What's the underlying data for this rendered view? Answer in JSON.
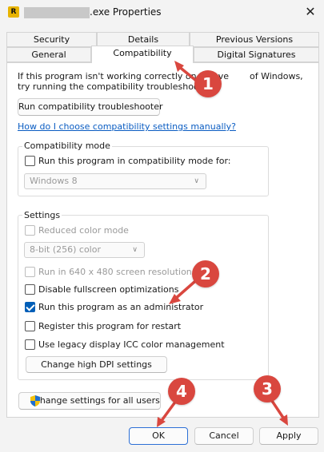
{
  "window": {
    "app_icon_letter": "R",
    "title": ".exe Properties",
    "close_icon": "close-icon"
  },
  "tabs_top": [
    {
      "label": "Security"
    },
    {
      "label": "Details"
    },
    {
      "label": "Previous Versions"
    }
  ],
  "tabs_bottom": [
    {
      "label": "General"
    },
    {
      "label": "Compatibility"
    },
    {
      "label": "Digital Signatures"
    }
  ],
  "active_tab": "Compatibility",
  "intro": {
    "line1_start": "If this program isn't working correctly on this ve",
    "line1_end": "of Windows,",
    "line2": "try running the compatibility troubleshooter."
  },
  "troubleshoot_button": "Run compatibility troubleshooter",
  "help_link": "How do I choose compatibility settings manually?",
  "compat_mode": {
    "label": "Compatibility mode",
    "checkbox_label": "Run this program in compatibility mode for:",
    "checked": false,
    "selected_os": "Windows 8"
  },
  "settings": {
    "label": "Settings",
    "reduced_color": {
      "label": "Reduced color mode",
      "checked": false
    },
    "color_select": "8-bit (256) color",
    "run_640": {
      "label": "Run in 640 x 480 screen resolution",
      "checked": false
    },
    "disable_fullscreen": {
      "label": "Disable fullscreen optimizations",
      "checked": false
    },
    "run_admin": {
      "label": "Run this program as an administrator",
      "checked": true
    },
    "register_restart": {
      "label": "Register this program for restart",
      "checked": false
    },
    "legacy_icc": {
      "label": "Use legacy display ICC color management",
      "checked": false
    },
    "dpi_button": "Change high DPI settings"
  },
  "all_users_button": "Change settings for all users",
  "footer": {
    "ok": "OK",
    "cancel": "Cancel",
    "apply": "Apply"
  },
  "annotations": [
    {
      "number": "1"
    },
    {
      "number": "2"
    },
    {
      "number": "3"
    },
    {
      "number": "4"
    }
  ],
  "colors": {
    "annotation_red": "#d9473f",
    "accent_blue": "#005fb8",
    "link_blue": "#0a5cc2"
  }
}
